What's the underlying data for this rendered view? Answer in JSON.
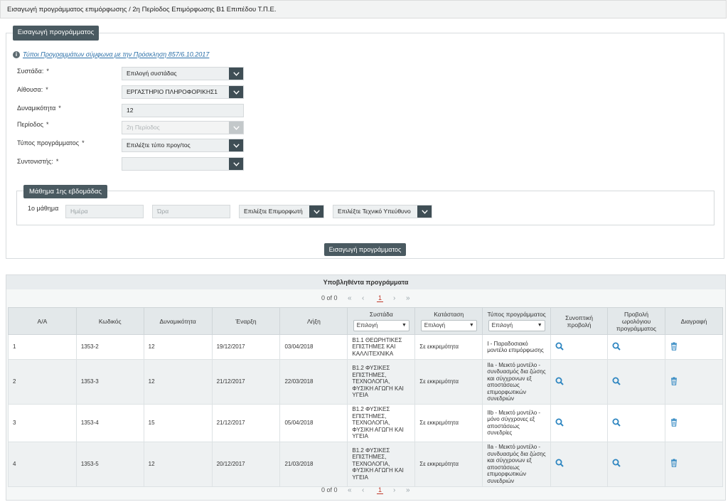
{
  "page": {
    "title": "Εισαγωγή προγράμματος επιμόρφωσης / 2η Περίοδος Επιμόρφωσης Β1 Επιπέδου Τ.Π.Ε."
  },
  "form": {
    "legend": "Εισαγωγή προγράμματος",
    "info_link": "Τύποι Προγραμμάτων σύμφωνα με την Πρόσκληση 857/6.10.2017",
    "required_mark": "*",
    "fields": {
      "systada": {
        "label": "Συστάδα:",
        "value": "Επιλογή συστάδας"
      },
      "aithousa": {
        "label": "Αίθουσα:",
        "value": "ΕΡΓΑΣΤΗΡΙΟ ΠΛΗΡΟΦΟΡΙΚΗΣ1"
      },
      "dynamikotita": {
        "label": "Δυναμικότητα",
        "value": "12"
      },
      "periodos": {
        "label": "Περίοδος",
        "value": "2η Περίοδος"
      },
      "typos": {
        "label": "Τύπος προγράμματος",
        "value": "Επιλέξτε τύπο προγ/τος"
      },
      "syntonistis": {
        "label": "Συντονιστής:",
        "value": ""
      }
    },
    "lesson_box": {
      "legend": "Μάθημα 1ης εβδομάδας",
      "row_label": "1ο μάθημα",
      "day_placeholder": "Ημέρα",
      "time_placeholder": "Ώρα",
      "trainer_select": "Επιλέξτε Επιμορφωτή",
      "tech_select": "Επιλέξτε Τεχνικό Υπεύθυνο"
    },
    "submit_label": "Εισαγωγή προγράμματος"
  },
  "table": {
    "title": "Υποβληθέντα προγράμματα",
    "pager": {
      "info": "0 of 0",
      "first": "«",
      "prev": "‹",
      "current": "1",
      "next": "›",
      "last": "»"
    },
    "columns": [
      "Α/Α",
      "Κωδικός",
      "Δυναμικότητα",
      "Έναρξη",
      "Λήξη",
      "Συστάδα",
      "Κατάσταση",
      "Τύπος προγράμματος",
      "Συνοπτική προβολή",
      "Προβολή ωρολόγιου προγράμματος",
      "Διαγραφή"
    ],
    "filter_label": "Επιλογή",
    "rows": [
      {
        "aa": "1",
        "code": "1353-2",
        "capacity": "12",
        "start": "19/12/2017",
        "end": "03/04/2018",
        "cluster": "Β1.1 ΘΕΩΡΗΤΙΚΕΣ ΕΠΙΣΤΗΜΕΣ ΚΑΙ ΚΑΛΛΙΤΕΧΝΙΚΑ",
        "status": "Σε εκκρεμότητα",
        "type": "Ι - Παραδοσιακό μοντέλο επιμόρφωσης"
      },
      {
        "aa": "2",
        "code": "1353-3",
        "capacity": "12",
        "start": "21/12/2017",
        "end": "22/03/2018",
        "cluster": "Β1.2 ΦΥΣΙΚΕΣ ΕΠΙΣΤΗΜΕΣ, ΤΕΧΝΟΛΟΓΙΑ, ΦΥΣΙΚΗ ΑΓΩΓΗ ΚΑΙ ΥΓΕΙΑ",
        "status": "Σε εκκρεμότητα",
        "type": "ΙΙa - Μεικτό μοντέλο - συνδυασμός δια ζώσης και σύγχρονων εξ αποστάσεως επιμορφωτικών συνεδριών"
      },
      {
        "aa": "3",
        "code": "1353-4",
        "capacity": "15",
        "start": "21/12/2017",
        "end": "05/04/2018",
        "cluster": "Β1.2 ΦΥΣΙΚΕΣ ΕΠΙΣΤΗΜΕΣ, ΤΕΧΝΟΛΟΓΙΑ, ΦΥΣΙΚΗ ΑΓΩΓΗ ΚΑΙ ΥΓΕΙΑ",
        "status": "Σε εκκρεμότητα",
        "type": "ΙΙb - Μεικτό μοντέλο - μόνο σύγχρονες εξ αποστάσεως συνεδρίες"
      },
      {
        "aa": "4",
        "code": "1353-5",
        "capacity": "12",
        "start": "20/12/2017",
        "end": "21/03/2018",
        "cluster": "Β1.2 ΦΥΣΙΚΕΣ ΕΠΙΣΤΗΜΕΣ, ΤΕΧΝΟΛΟΓΙΑ, ΦΥΣΙΚΗ ΑΓΩΓΗ ΚΑΙ ΥΓΕΙΑ",
        "status": "Σε εκκρεμότητα",
        "type": "ΙΙa - Μεικτό μοντέλο - συνδυασμός δια ζώσης και σύγχρονων εξ αποστάσεως επιμορφωτικών συνεδριών"
      }
    ]
  },
  "icons": {
    "view": "search-icon",
    "schedule": "search-icon",
    "delete": "trash-icon",
    "info": "info-icon",
    "dropdown": "chevron-down-icon"
  },
  "colors": {
    "accent": "#4a5a61",
    "link": "#2a6fa8",
    "icon": "#2e86c1",
    "pager_current": "#c0392b"
  }
}
